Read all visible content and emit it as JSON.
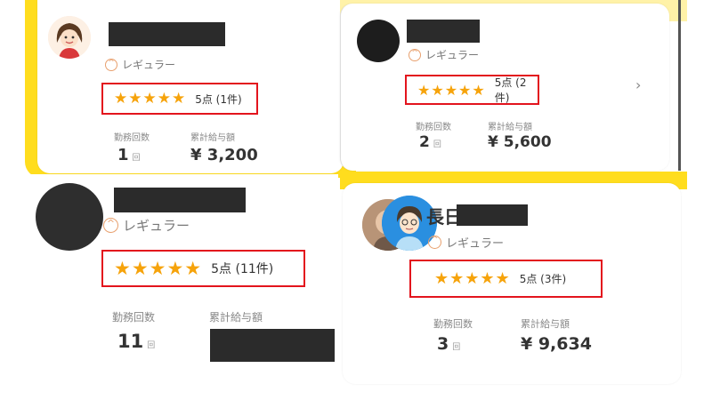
{
  "cards": [
    {
      "rank_label": "レギュラー",
      "stars": "★★★★★",
      "rating_text": "5点 (1件)",
      "stat_labels": {
        "count": "勤務回数",
        "wage": "累計給与額"
      },
      "count_value": "1",
      "count_unit": "回",
      "wage_value": "¥ 3,200"
    },
    {
      "rank_label": "レギュラー",
      "stars": "★★★★★",
      "rating_text": "5点 (2件)",
      "stat_labels": {
        "count": "勤務回数",
        "wage": "累計給与額"
      },
      "count_value": "2",
      "count_unit": "回",
      "wage_value": "¥ 5,600",
      "chevron": "›"
    },
    {
      "rank_label": "レギュラー",
      "stars": "★★★★★",
      "rating_text": "5点 (11件)",
      "stat_labels": {
        "count": "勤務回数",
        "wage": "累計給与額"
      },
      "count_value": "11",
      "count_unit": "回"
    },
    {
      "name_partial": "長日",
      "rank_label": "レギュラー",
      "stars": "★★★★★",
      "rating_text": "5点 (3件)",
      "stat_labels": {
        "count": "勤務回数",
        "wage": "累計給与額"
      },
      "count_value": "3",
      "count_unit": "回",
      "wage_value": "¥ 9,634"
    }
  ],
  "colors": {
    "accent_yellow": "#ffdd1e",
    "highlight_red": "#e3141d",
    "star_orange": "#f6a30b"
  },
  "icons": [
    "rank-icon",
    "star-icon",
    "chevron-right-icon"
  ]
}
